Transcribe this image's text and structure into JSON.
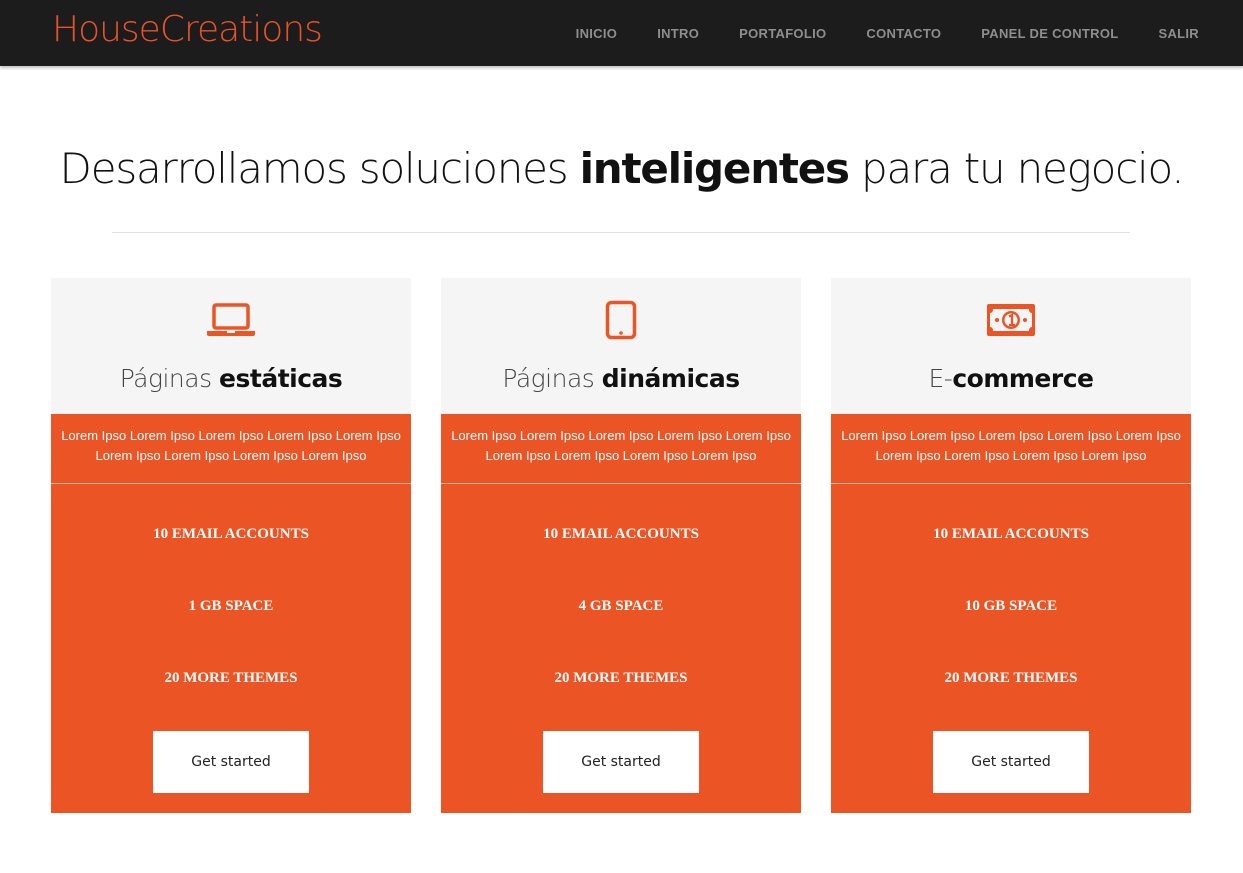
{
  "nav": {
    "brand": "HouseCreations",
    "links": [
      "INICIO",
      "INTRO",
      "PORTAFOLIO",
      "CONTACTO",
      "PANEL DE CONTROL",
      "SALIR"
    ]
  },
  "hero": {
    "part1": "Desarrollamos soluciones ",
    "bold": "inteligentes",
    "part2": " para tu negocio."
  },
  "colors": {
    "accent": "#eb5525",
    "nav_bg": "#1c1c1c",
    "card_head_bg": "#f5f5f5"
  },
  "plans": [
    {
      "icon": "laptop-icon",
      "title_light": "Páginas ",
      "title_bold": "estáticas",
      "description": "Lorem Ipso Lorem Ipso Lorem Ipso Lorem Ipso Lorem Ipso Lorem Ipso Lorem Ipso Lorem Ipso Lorem Ipso",
      "features": [
        "10 EMAIL ACCOUNTS",
        "1 GB SPACE",
        "20 MORE THEMES"
      ],
      "button": "Get started"
    },
    {
      "icon": "tablet-icon",
      "title_light": "Páginas ",
      "title_bold": "dinámicas",
      "description": "Lorem Ipso Lorem Ipso Lorem Ipso Lorem Ipso Lorem Ipso Lorem Ipso Lorem Ipso Lorem Ipso Lorem Ipso",
      "features": [
        "10 EMAIL ACCOUNTS",
        "4 GB SPACE",
        "20 MORE THEMES"
      ],
      "button": "Get started"
    },
    {
      "icon": "money-bill-icon",
      "title_light": "E-",
      "title_bold": "commerce",
      "description": "Lorem Ipso Lorem Ipso Lorem Ipso Lorem Ipso Lorem Ipso Lorem Ipso Lorem Ipso Lorem Ipso Lorem Ipso",
      "features": [
        "10 EMAIL ACCOUNTS",
        "10 GB SPACE",
        "20 MORE THEMES"
      ],
      "button": "Get started"
    }
  ]
}
